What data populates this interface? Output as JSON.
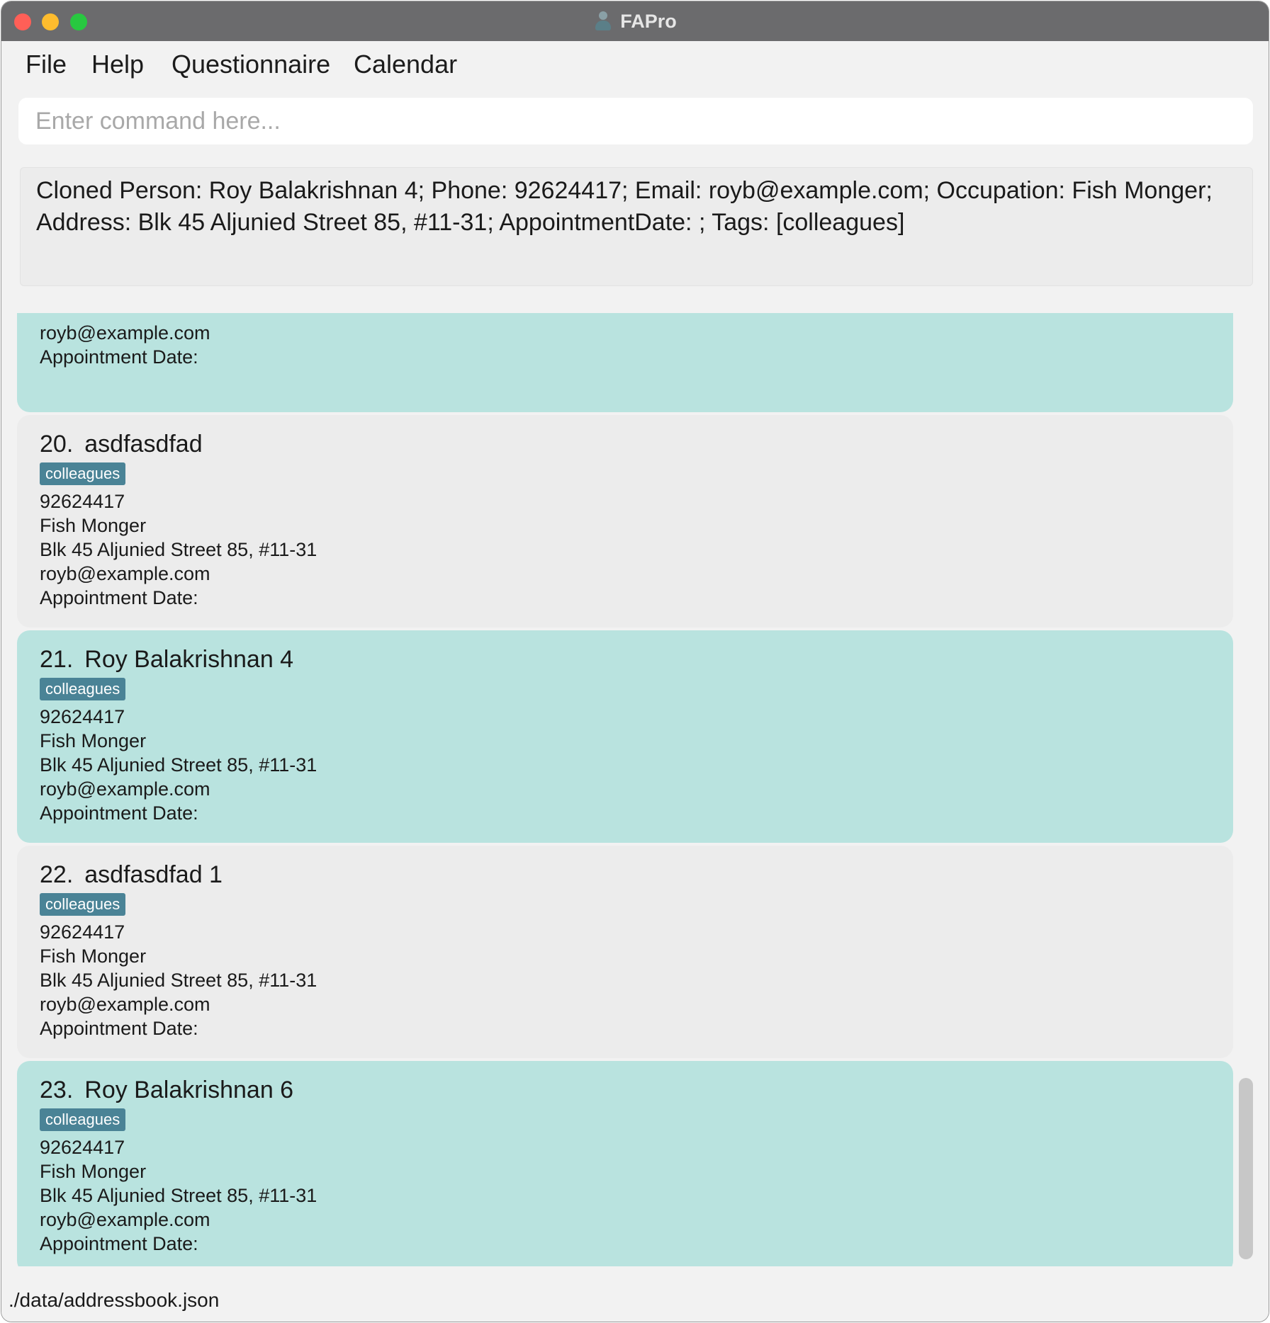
{
  "window": {
    "title": "FAPro",
    "app_icon": "person-icon",
    "controls": [
      "close",
      "minimize",
      "maximize"
    ]
  },
  "menu": {
    "file": "File",
    "help": "Help",
    "questionnaire": "Questionnaire",
    "calendar": "Calendar"
  },
  "command": {
    "placeholder": "Enter command here...",
    "value": ""
  },
  "result": {
    "line1": "Cloned Person: Roy Balakrishnan 4; Phone: 92624417; Email: royb@example.com; Occupation: Fish Monger;",
    "line2": "Address: Blk 45 Aljunied Street 85, #11-31; AppointmentDate: ; Tags: [colleagues]"
  },
  "partial_card": {
    "email": "royb@example.com",
    "appointment": "Appointment Date:"
  },
  "persons": [
    {
      "index": "20.",
      "name": "asdfasdfad",
      "tag": "colleagues",
      "phone": "92624417",
      "occupation": "Fish Monger",
      "address": "Blk 45 Aljunied Street 85, #11-31",
      "email": "royb@example.com",
      "appointment": "Appointment Date:"
    },
    {
      "index": "21.",
      "name": "Roy Balakrishnan 4",
      "tag": "colleagues",
      "phone": "92624417",
      "occupation": "Fish Monger",
      "address": "Blk 45 Aljunied Street 85, #11-31",
      "email": "royb@example.com",
      "appointment": "Appointment Date:"
    },
    {
      "index": "22.",
      "name": "asdfasdfad 1",
      "tag": "colleagues",
      "phone": "92624417",
      "occupation": "Fish Monger",
      "address": "Blk 45 Aljunied Street 85, #11-31",
      "email": "royb@example.com",
      "appointment": "Appointment Date:"
    },
    {
      "index": "23.",
      "name": "Roy Balakrishnan 6",
      "tag": "colleagues",
      "phone": "92624417",
      "occupation": "Fish Monger",
      "address": "Blk 45 Aljunied Street 85, #11-31",
      "email": "royb@example.com",
      "appointment": "Appointment Date:"
    }
  ],
  "colors": {
    "card_odd": "#b9e3df",
    "card_even": "#ececec",
    "tag": "#4a8396"
  },
  "status": {
    "file_path": "./data/addressbook.json"
  }
}
